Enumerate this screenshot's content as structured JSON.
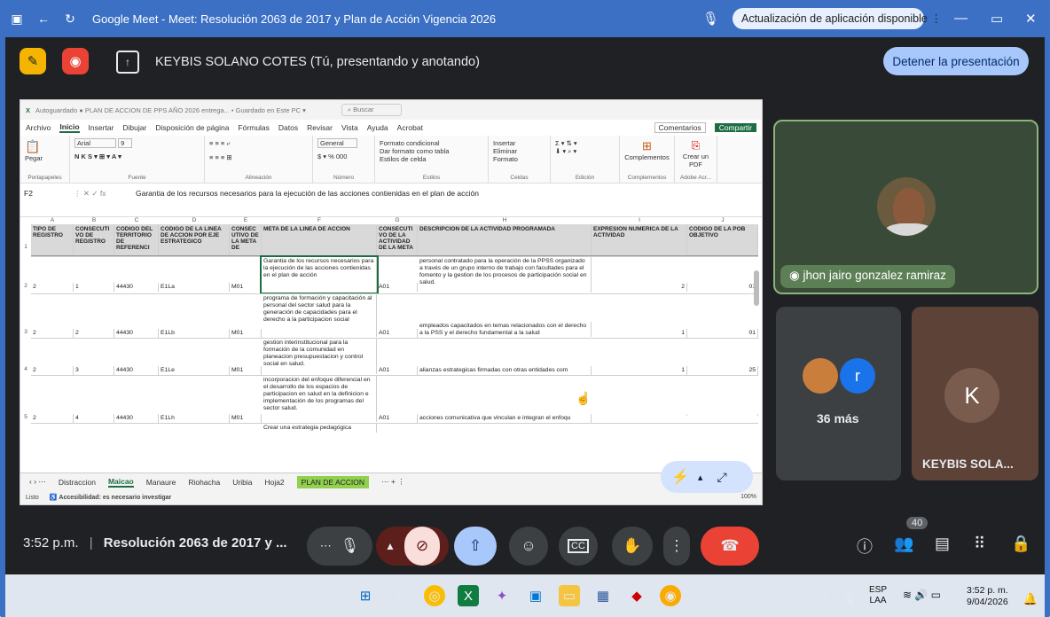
{
  "browser": {
    "title": "Google Meet - Meet: Resolución 2063 de 2017 y Plan de Acción Vigencia 2026",
    "update_label": "Actualización de aplicación disponible"
  },
  "presenter_bar": {
    "presenting_text": "KEYBIS SOLANO COTES (Tú, presentando y anotando)",
    "stop_label": "Detener la presentación"
  },
  "excel": {
    "title": "Autoguardado  ●   PLAN DE ACCION DE PPS AÑO 2026 entrega...  • Guardado en Este PC ▾",
    "search": "Buscar",
    "menu": [
      "Archivo",
      "Inicio",
      "Insertar",
      "Dibujar",
      "Disposición de página",
      "Fórmulas",
      "Datos",
      "Revisar",
      "Vista",
      "Ayuda",
      "Acrobat"
    ],
    "comments_label": "Comentarios",
    "share_label": "Compartir",
    "ribbon": {
      "paste": "Pegar",
      "font_name": "Arial",
      "font_size": "9",
      "number_format": "General",
      "cond_format": "Formato condicional",
      "table_format": "Dar formato como tabla",
      "cell_styles": "Estilos de celda",
      "insert": "Insertar",
      "delete": "Eliminar",
      "format": "Formato",
      "complements": "Complementos",
      "create_pdf": "Crear un PDF",
      "group_labels": [
        "Portapapeles",
        "Fuente",
        "Alineación",
        "Número",
        "Estilos",
        "Celdas",
        "Edición",
        "Complementos",
        "Adobe Acr..."
      ]
    },
    "name_box": "F2",
    "formula": "Garantia de los recursos necesarios para la ejecución de las acciones contienidas en el plan de acción",
    "col_letters": [
      "A",
      "B",
      "C",
      "D",
      "E",
      "F",
      "G",
      "H",
      "I",
      "J"
    ],
    "headers": [
      "TIPO DE REGISTRO",
      "CONSECUTI VO DE REGISTRO",
      "CODIGO DEL TERRITORIO DE REFERENCI",
      "CODIGO DE LA LINEA DE ACCION POR EJE ESTRATEGICO",
      "CONSEC UTIVO DE LA META DE",
      "META DE LA LINEA DE ACCION",
      "CONSECUTI VO DE LA ACTIVIDAD DE LA META",
      "DESCRIPCION DE LA ACTIVIDAD PROGRAMADA",
      "EXPRESION NUMERICA DE LA ACTIVIDAD",
      "CODIGO DE LA POB OBJETIVO"
    ],
    "rows": [
      {
        "num": "2",
        "a": "2",
        "b": "1",
        "c": "44430",
        "d": "E1La",
        "e": "M01",
        "f": "Garantia de los recursos necesarios para la ejecución de las acciones contienidas en el plan de acción",
        "g": "A01",
        "h": "personal contratado para la operación de la PPSS organizado a través de un grupo interno de trabajo con facultades para el fomento y la gestion de los procesos de participación social en salud.",
        "i": "2",
        "j": "01"
      },
      {
        "num": "3",
        "a": "2",
        "b": "2",
        "c": "44430",
        "d": "E1Lb",
        "e": "M01",
        "f": "programa de formación y capacitación al personal del sector salud para la generación de capacidades para el derecho a la participacion social",
        "g": "A01",
        "h": "empleados capacitados en temas relacionados con el derecho a la PSS y el derecho fundamental a la salud",
        "i": "1",
        "j": "01"
      },
      {
        "num": "4",
        "a": "2",
        "b": "3",
        "c": "44430",
        "d": "E1Le",
        "e": "M01",
        "f": "gestion interinstitucional para la formación de la comunidad en planeacion presupuestacion y control social en salud.",
        "g": "A01",
        "h": "alianzas estrategicas firmadas con otras entidades com",
        "i": "1",
        "j": "25"
      },
      {
        "num": "5",
        "a": "2",
        "b": "4",
        "c": "44430",
        "d": "E1Lh",
        "e": "M01",
        "f": "incorporacion del enfoque diferencial en el desarrollo de los espacios de participacion en salud en la definicion e implementación de los programas del sector salud.",
        "g": "A01",
        "h": "acciones comunicativa que vinculan e integran el enfoqu",
        "i": "",
        "j": ""
      }
    ],
    "next_row_text": "Crear una estrategia pedagógica",
    "sheet_tabs": [
      "Distraccion",
      "Maicao",
      "Manaure",
      "Riohacha",
      "Uribia",
      "Hoja2",
      "PLAN DE ACCION"
    ],
    "active_tab": "Maicao",
    "status_left": "Listo",
    "status_access": "Accesibilidad: es necesario investigar",
    "zoom": "100%"
  },
  "participants": {
    "main_name": "jhon jairo gonzalez ramiraz",
    "more_avatar_letter": "r",
    "more_label": "36 más",
    "tile_letter": "K",
    "tile_name": "KEYBIS SOLA..."
  },
  "meeting_bar": {
    "time": "3:52 p.m.",
    "separator": "|",
    "title": "Resolución 2063 de 2017 y ...",
    "participant_count": "40"
  },
  "taskbar": {
    "lang_top": "ESP",
    "lang_bottom": "LAA",
    "clock_time": "3:52 p. m.",
    "clock_date": "9/04/2026"
  },
  "colors": {
    "browser_blue": "#3c70c4",
    "meet_dark": "#202124",
    "stop_button": "#a8c7fa",
    "end_call_red": "#ea4335",
    "excel_green": "#1d6f42"
  }
}
